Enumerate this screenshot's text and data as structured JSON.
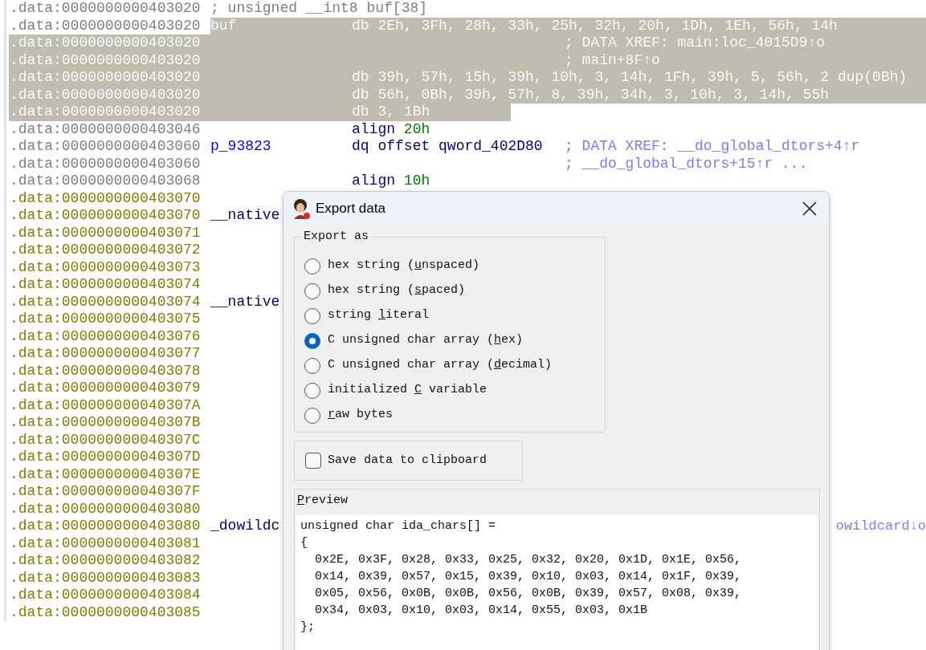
{
  "listing": [
    {
      "address": ".data:0000000000403020",
      "kind": "defined",
      "note": "; unsigned __int8 buf[38]",
      "selected": false
    },
    {
      "address": ".data:0000000000403020",
      "kind": "defined",
      "label": "buf",
      "mnemonic": "db",
      "operands": "2Eh, 3Fh, 28h, 33h, 25h, 32h, 20h, 1Dh, 1Eh, 56h, 14h",
      "selected": true
    },
    {
      "address": ".data:0000000000403020",
      "kind": "defined",
      "comment": "; DATA XREF: main:loc_4015D9↑o",
      "selected": true
    },
    {
      "address": ".data:0000000000403020",
      "kind": "defined",
      "comment": "; main+8F↑o",
      "selected": true
    },
    {
      "address": ".data:0000000000403020",
      "kind": "defined",
      "mnemonic": "db",
      "operands": "39h, 57h, 15h, 39h, 10h, 3, 14h, 1Fh, 39h, 5, 56h, 2 dup(0Bh)",
      "selected": true
    },
    {
      "address": ".data:0000000000403020",
      "kind": "defined",
      "mnemonic": "db",
      "operands": "56h, 0Bh, 39h, 57h, 8, 39h, 34h, 3, 10h, 3, 14h, 55h",
      "selected": true
    },
    {
      "address": ".data:0000000000403020",
      "kind": "defined",
      "mnemonic": "db",
      "operands": "3, 1Bh",
      "selected": true
    },
    {
      "address": ".data:0000000000403046",
      "kind": "defined",
      "mnemonic": "align",
      "operands": "20h",
      "numeric_operand": true,
      "selected": false
    },
    {
      "address": ".data:0000000000403060",
      "kind": "defined",
      "label": "p_93823",
      "mnemonic": "dq",
      "operands": "offset qword_402D80",
      "numeric_operand": false,
      "comment": "; DATA XREF: __do_global_dtors+4↑r",
      "selected": false
    },
    {
      "address": ".data:0000000000403060",
      "kind": "defined",
      "comment": "; __do_global_dtors+15↑r ...",
      "selected": false
    },
    {
      "address": ".data:0000000000403068",
      "kind": "defined",
      "mnemonic": "align",
      "operands": "10h",
      "numeric_operand": true,
      "selected": false
    },
    {
      "address": ".data:0000000000403070",
      "kind": "unexplored",
      "selected": false
    },
    {
      "address": ".data:0000000000403070",
      "kind": "unexplored",
      "label": "__native",
      "selected": false
    },
    {
      "address": ".data:0000000000403071",
      "kind": "unexplored",
      "selected": false
    },
    {
      "address": ".data:0000000000403072",
      "kind": "unexplored",
      "selected": false
    },
    {
      "address": ".data:0000000000403073",
      "kind": "unexplored",
      "selected": false
    },
    {
      "address": ".data:0000000000403074",
      "kind": "unexplored",
      "selected": false
    },
    {
      "address": ".data:0000000000403074",
      "kind": "unexplored",
      "label": "__native",
      "selected": false
    },
    {
      "address": ".data:0000000000403075",
      "kind": "unexplored",
      "selected": false
    },
    {
      "address": ".data:0000000000403076",
      "kind": "unexplored",
      "selected": false
    },
    {
      "address": ".data:0000000000403077",
      "kind": "unexplored",
      "selected": false
    },
    {
      "address": ".data:0000000000403078",
      "kind": "unexplored",
      "selected": false
    },
    {
      "address": ".data:0000000000403079",
      "kind": "unexplored",
      "selected": false
    },
    {
      "address": ".data:000000000040307A",
      "kind": "unexplored",
      "selected": false
    },
    {
      "address": ".data:000000000040307B",
      "kind": "unexplored",
      "selected": false
    },
    {
      "address": ".data:000000000040307C",
      "kind": "unexplored",
      "selected": false
    },
    {
      "address": ".data:000000000040307D",
      "kind": "unexplored",
      "selected": false
    },
    {
      "address": ".data:000000000040307E",
      "kind": "unexplored",
      "selected": false
    },
    {
      "address": ".data:000000000040307F",
      "kind": "unexplored",
      "selected": false
    },
    {
      "address": ".data:0000000000403080",
      "kind": "unexplored",
      "selected": false
    },
    {
      "address": ".data:0000000000403080",
      "kind": "unexplored",
      "label": "_dowildc",
      "right_fragment": "owildcard↓o",
      "selected": false
    },
    {
      "address": ".data:0000000000403081",
      "kind": "unexplored",
      "selected": false
    },
    {
      "address": ".data:0000000000403082",
      "kind": "unexplored",
      "selected": false
    },
    {
      "address": ".data:0000000000403083",
      "kind": "unexplored",
      "selected": false
    },
    {
      "address": ".data:0000000000403084",
      "kind": "unexplored",
      "selected": false
    },
    {
      "address": ".data:0000000000403085",
      "kind": "unexplored",
      "selected": false
    }
  ],
  "dialog": {
    "title": "Export data",
    "export_as": {
      "title": "Export as",
      "options": [
        {
          "before": "hex string (",
          "key": "u",
          "after": "nspaced)",
          "selected": false
        },
        {
          "before": "hex string (",
          "key": "s",
          "after": "paced)",
          "selected": false
        },
        {
          "before": "string ",
          "key": "l",
          "after": "iteral",
          "selected": false
        },
        {
          "before": "C unsigned char array (",
          "key": "h",
          "after": "ex)",
          "selected": true
        },
        {
          "before": "C unsigned char array (",
          "key": "d",
          "after": "ecimal)",
          "selected": false
        },
        {
          "before": "initialized ",
          "key": "C",
          "after": " variable",
          "selected": false
        },
        {
          "key": "r",
          "after": "aw bytes",
          "selected": false
        }
      ]
    },
    "clipboard": {
      "label": "Save data to clipboard",
      "checked": false
    },
    "preview": {
      "key": "P",
      "after": "review",
      "lines": [
        "unsigned char ida_chars[] =",
        "{",
        "  0x2E, 0x3F, 0x28, 0x33, 0x25, 0x32, 0x20, 0x1D, 0x1E, 0x56,",
        "  0x14, 0x39, 0x57, 0x15, 0x39, 0x10, 0x03, 0x14, 0x1F, 0x39,",
        "  0x05, 0x56, 0x0B, 0x0B, 0x56, 0x0B, 0x39, 0x57, 0x08, 0x39,",
        "  0x34, 0x03, 0x10, 0x03, 0x14, 0x55, 0x03, 0x1B",
        "};"
      ]
    }
  }
}
